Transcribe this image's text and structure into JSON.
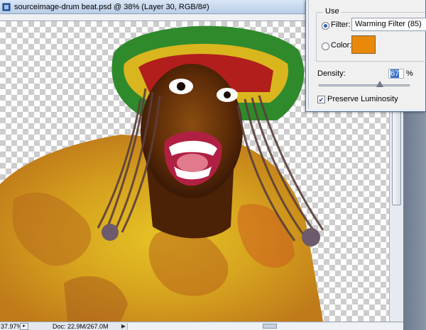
{
  "document": {
    "title": "sourceimage-drum beat.psd @ 38% (Layer 30, RGB/8#)",
    "zoom": "37.97%",
    "doc_info": "Doc: 22.9M/267.0M"
  },
  "dialog": {
    "group_label": "Use",
    "filter_label": "Filter:",
    "filter_value": "Warming Filter (85)",
    "color_label": "Color:",
    "color_swatch": "#e8890c",
    "density_label": "Density:",
    "density_value": "67",
    "density_unit": "%",
    "density_level": 0.67,
    "preserve_label": "Preserve Luminosity",
    "preserve_checked": true
  }
}
